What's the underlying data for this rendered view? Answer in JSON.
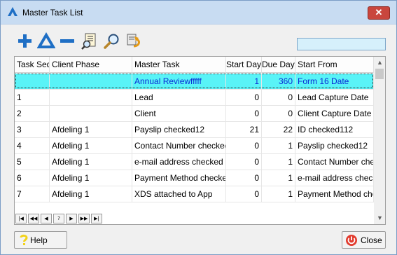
{
  "window": {
    "title": "Master Task List",
    "close_glyph": "✕"
  },
  "toolbar": {
    "buttons": [
      {
        "name": "add-button",
        "icon": "plus-icon"
      },
      {
        "name": "edit-button",
        "icon": "triangle-icon"
      },
      {
        "name": "delete-button",
        "icon": "minus-icon"
      },
      {
        "name": "report-button",
        "icon": "report-search-icon"
      },
      {
        "name": "search-button",
        "icon": "magnifier-icon"
      },
      {
        "name": "undo-button",
        "icon": "undo-icon"
      }
    ],
    "search_value": ""
  },
  "grid": {
    "columns": [
      "Task Seq",
      "Client Phase",
      "Master Task",
      "Start Day",
      "Due Day",
      "Start From"
    ],
    "rows": [
      {
        "seq": "",
        "phase": "",
        "task": "Annual Reviewfffff",
        "start": "1",
        "due": "360",
        "from": "Form 16 Date",
        "selected": true
      },
      {
        "seq": "1",
        "phase": "",
        "task": "Lead",
        "start": "0",
        "due": "0",
        "from": "Lead Capture Date"
      },
      {
        "seq": "2",
        "phase": "",
        "task": "Client",
        "start": "0",
        "due": "0",
        "from": "Client Capture Date"
      },
      {
        "seq": "3",
        "phase": "Afdeling 1",
        "task": "Payslip checked12",
        "start": "21",
        "due": "22",
        "from": "ID checked112"
      },
      {
        "seq": "4",
        "phase": "Afdeling 1",
        "task": "Contact Number checked",
        "start": "0",
        "due": "1",
        "from": "Payslip checked12"
      },
      {
        "seq": "5",
        "phase": "Afdeling 1",
        "task": "e-mail address checked",
        "start": "0",
        "due": "1",
        "from": "Contact Number checke"
      },
      {
        "seq": "6",
        "phase": "Afdeling 1",
        "task": "Payment Method checked",
        "start": "0",
        "due": "1",
        "from": "e-mail address checke"
      },
      {
        "seq": "7",
        "phase": "Afdeling 1",
        "task": "XDS attached to App",
        "start": "0",
        "due": "1",
        "from": "Payment Method checke"
      }
    ]
  },
  "navigator": {
    "buttons": [
      {
        "name": "nav-first-button",
        "glyph": "|◀"
      },
      {
        "name": "nav-prior-page-button",
        "glyph": "◀◀"
      },
      {
        "name": "nav-prior-button",
        "glyph": "◀"
      },
      {
        "name": "nav-help-button",
        "glyph": "?"
      },
      {
        "name": "nav-next-button",
        "glyph": "▶"
      },
      {
        "name": "nav-next-page-button",
        "glyph": "▶▶"
      },
      {
        "name": "nav-last-button",
        "glyph": "▶|"
      }
    ]
  },
  "footer": {
    "help_label": "Help",
    "close_label": "Close"
  },
  "colors": {
    "selected_row": "#59f3f7",
    "selected_text": "#0a2bd6",
    "toolbar_icon": "#1f6fc5"
  }
}
